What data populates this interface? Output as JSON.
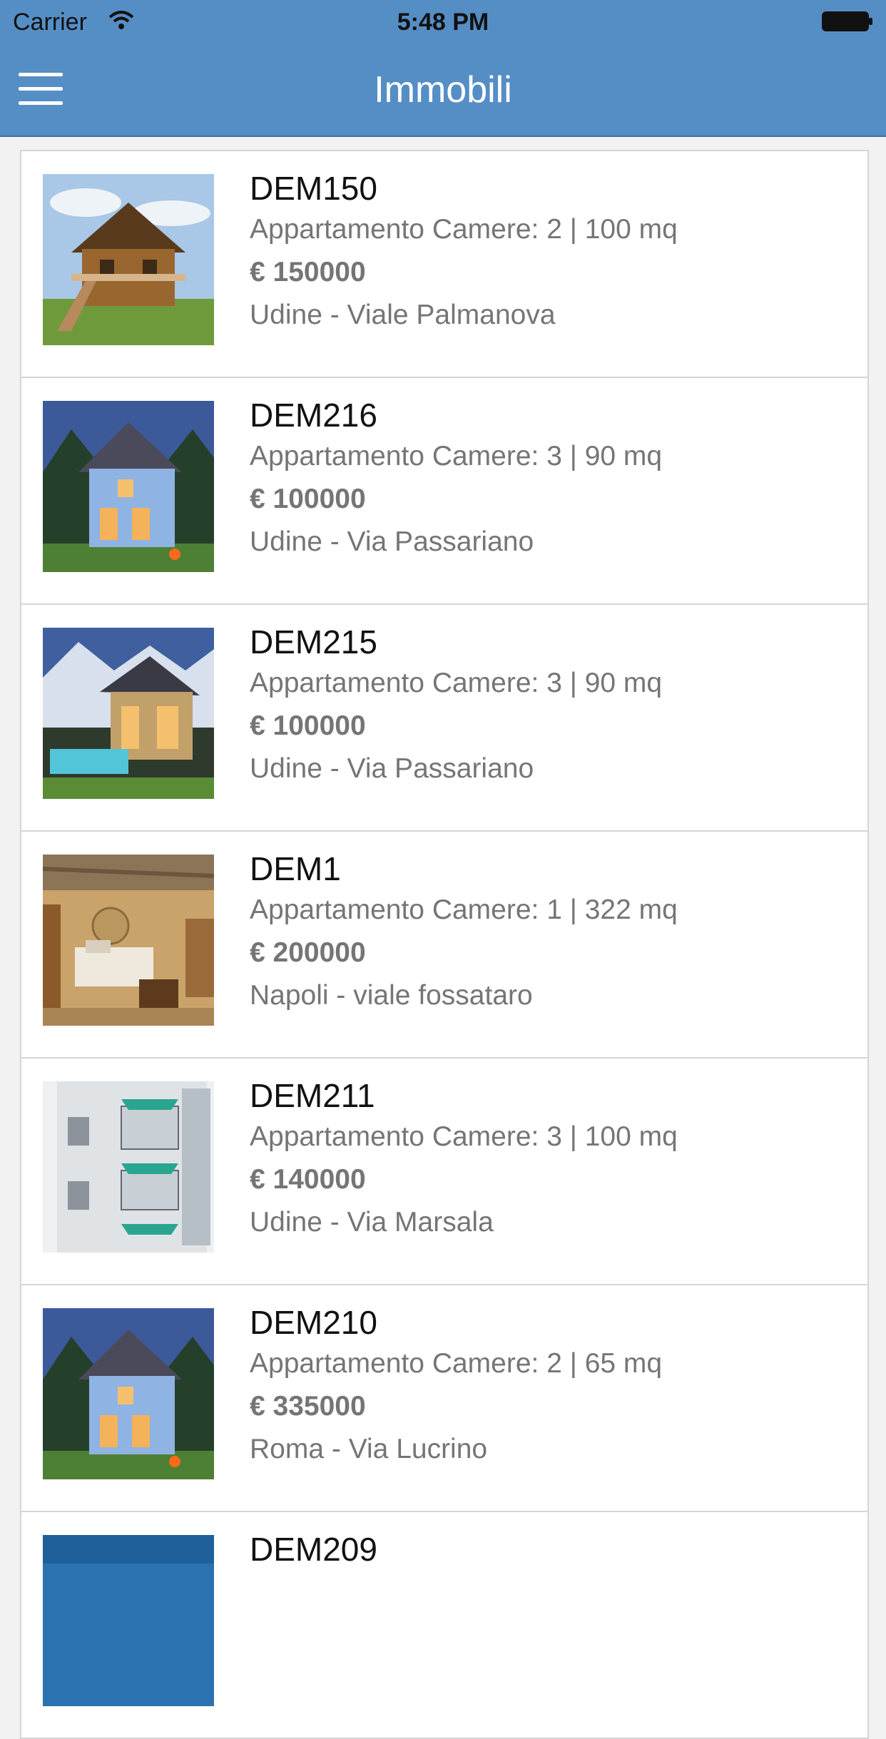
{
  "status_bar": {
    "carrier": "Carrier",
    "time": "5:48 PM"
  },
  "nav": {
    "title": "Immobili"
  },
  "listings": [
    {
      "code": "DEM150",
      "desc": "Appartamento Camere: 2 | 100 mq",
      "price": "€ 150000",
      "location": "Udine - Viale Palmanova"
    },
    {
      "code": "DEM216",
      "desc": "Appartamento Camere: 3 | 90 mq",
      "price": "€ 100000",
      "location": "Udine - Via Passariano"
    },
    {
      "code": "DEM215",
      "desc": "Appartamento Camere: 3 | 90 mq",
      "price": "€ 100000",
      "location": "Udine - Via Passariano"
    },
    {
      "code": "DEM1",
      "desc": "Appartamento Camere: 1 | 322 mq",
      "price": "€ 200000",
      "location": "Napoli - viale fossataro"
    },
    {
      "code": "DEM211",
      "desc": "Appartamento Camere: 3 | 100 mq",
      "price": "€ 140000",
      "location": "Udine - Via Marsala"
    },
    {
      "code": "DEM210",
      "desc": "Appartamento Camere: 2 | 65 mq",
      "price": "€ 335000",
      "location": "Roma - Via Lucrino"
    },
    {
      "code": "DEM209",
      "desc": "",
      "price": "",
      "location": ""
    }
  ]
}
